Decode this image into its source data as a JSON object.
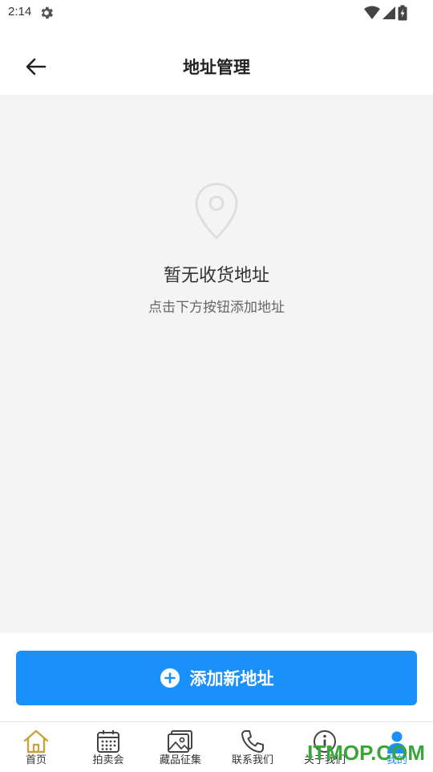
{
  "status_bar": {
    "time": "2:14",
    "icons": [
      "gear-icon",
      "wifi-icon",
      "signal-icon",
      "battery-icon"
    ]
  },
  "header": {
    "title": "地址管理",
    "back_icon": "arrow-left-icon"
  },
  "empty_state": {
    "icon": "location-pin-icon",
    "title": "暂无收货地址",
    "hint": "点击下方按钮添加地址"
  },
  "add_button": {
    "icon": "plus-circle-icon",
    "label": "添加新地址"
  },
  "bottom_nav": {
    "items": [
      {
        "label": "首页",
        "icon": "home-icon",
        "active": false
      },
      {
        "label": "拍卖会",
        "icon": "calendar-icon",
        "active": false
      },
      {
        "label": "藏品征集",
        "icon": "image-icon",
        "active": false
      },
      {
        "label": "联系我们",
        "icon": "phone-icon",
        "active": false
      },
      {
        "label": "关于我们",
        "icon": "info-icon",
        "active": false
      },
      {
        "label": "我的",
        "icon": "user-icon",
        "active": true
      }
    ]
  },
  "watermark": "ITMOP.COM",
  "colors": {
    "primary": "#1a90fb",
    "home_icon": "#c9a23a",
    "background": "#f4f4f4",
    "watermark": "#39a53a"
  }
}
